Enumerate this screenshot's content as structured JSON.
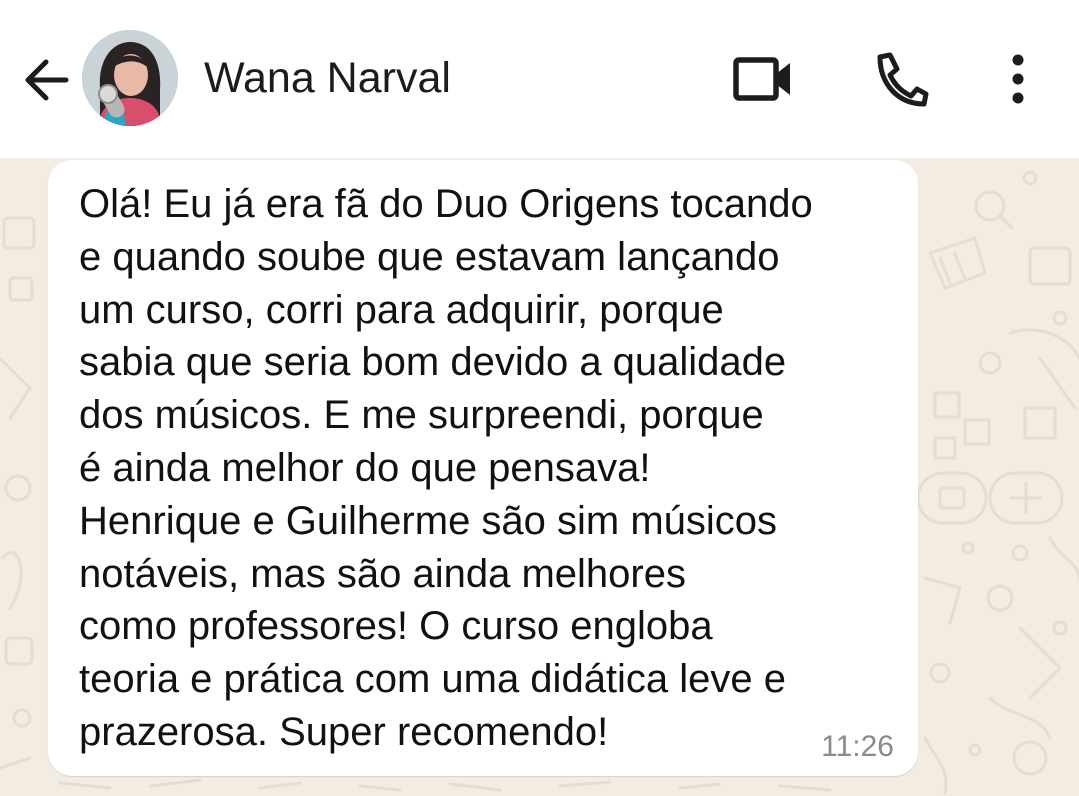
{
  "header": {
    "contact_name": "Wana Narval",
    "icons": {
      "back": "arrow-left-icon",
      "avatar": "profile-photo",
      "video": "video-camera-icon",
      "call": "phone-icon",
      "menu": "more-vertical-icon"
    }
  },
  "message": {
    "lines": [
      "Olá! Eu já era fã do Duo Origens tocando",
      "e quando soube que estavam lançando",
      "um curso, corri para adquirir, porque",
      "sabia que seria bom devido a qualidade",
      "dos músicos. E me surpreendi, porque",
      "é ainda melhor do que pensava!",
      "Henrique e Guilherme são sim músicos",
      "notáveis, mas são ainda melhores",
      "como professores! O curso engloba",
      "teoria e prática com uma didática leve e",
      "prazerosa. Super recomendo!"
    ],
    "time": "11:26"
  },
  "colors": {
    "header_bg": "#ffffff",
    "icon": "#1c1c1c",
    "chat_bg": "#f3ece3",
    "wallpaper_doodle": "#e6ddd2",
    "bubble": "#ffffff",
    "text": "#111111",
    "timestamp": "#8a8a8a"
  }
}
